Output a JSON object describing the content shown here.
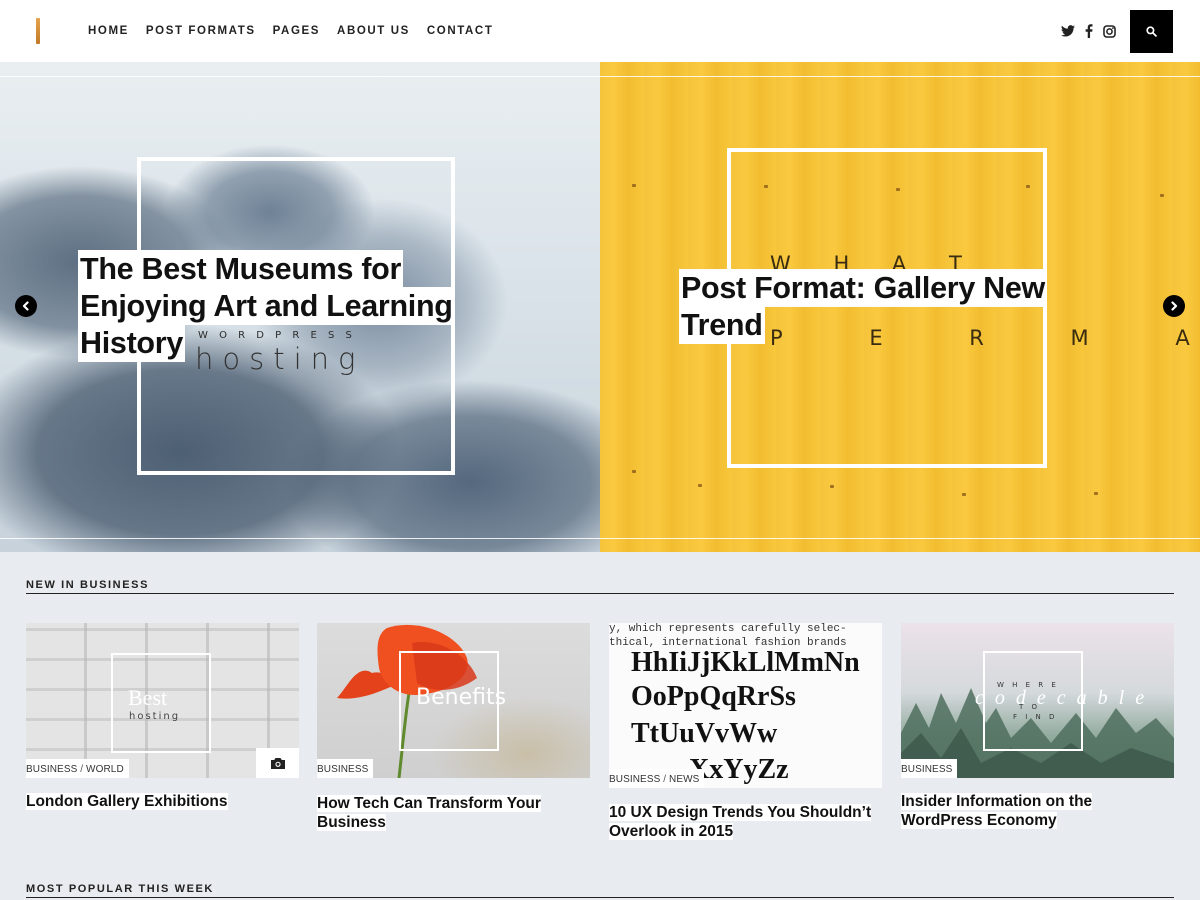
{
  "nav": {
    "items": [
      "HOME",
      "POST FORMATS",
      "PAGES",
      "ABOUT US",
      "CONTACT"
    ]
  },
  "social": {
    "twitter": "twitter-icon",
    "facebook": "facebook-icon",
    "instagram": "instagram-icon",
    "search": "search-icon"
  },
  "hero": {
    "slides": [
      {
        "title": "The Best Museums for Enjoying Art and Learning History",
        "image_text_small": "W O R D P R E S S",
        "image_text_large": "hosting"
      },
      {
        "title": "Post Format: Gallery New Trend",
        "image_text_top": "W H A T",
        "image_text_bottom": "P E R M A L I"
      }
    ],
    "prev_icon": "chevron-left-icon",
    "next_icon": "chevron-right-icon"
  },
  "sections": {
    "business": "NEW IN BUSINESS",
    "popular": "MOST POPULAR THIS WEEK"
  },
  "cards": [
    {
      "title": "London Gallery Exhibitions",
      "cat1": "BUSINESS",
      "sep": "/",
      "cat2": "WORLD",
      "image_text": "Best",
      "image_subtext": "hosting",
      "media_icon": "camera-icon"
    },
    {
      "title": "How Tech Can Transform Your Business",
      "cat1": "BUSINESS",
      "image_text": "Benefits"
    },
    {
      "title": "10 UX Design Trends You Shouldn’t Overlook in 2015",
      "cat1": "BUSINESS",
      "sep": "/",
      "cat2": "NEWS",
      "image_lines": [
        "y, which represents carefully selec-",
        "thical, international fashion brands",
        "HhIiJjKkLlMmNn",
        "OoPpQqRrSs",
        "TtUuVvWw",
        "XxYyZz"
      ]
    },
    {
      "title": "Insider Information on the WordPress Economy",
      "cat1": "BUSINESS",
      "image_text": "codecable",
      "image_small_top": "W H E R E",
      "image_small_mid": "T O",
      "image_small_bottom": "F I N D"
    }
  ],
  "colors": {
    "accent_yellow": "#f6c43a",
    "nav_text": "#222222",
    "page_bg": "#e8ebef"
  }
}
